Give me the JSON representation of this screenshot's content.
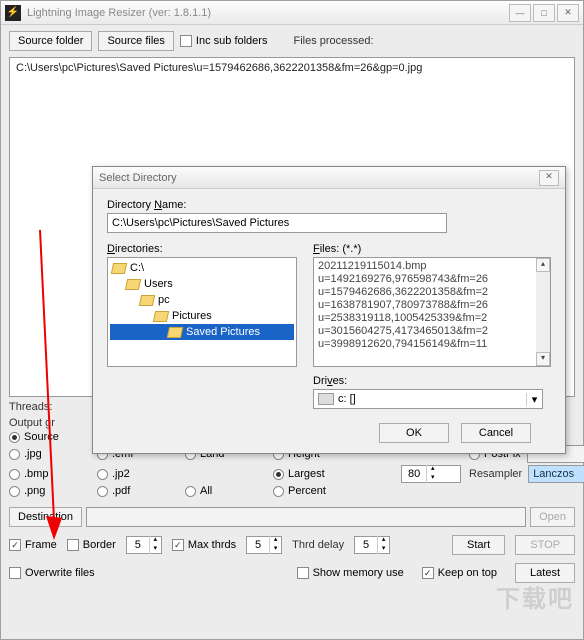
{
  "window": {
    "title": "Lightning Image Resizer (ver: 1.8.1.1)",
    "source_folder": "Source folder",
    "source_files": "Source files",
    "inc_sub": "Inc sub folders",
    "files_processed": "Files processed:",
    "file_path": "C:\\Users\\pc\\Pictures\\Saved Pictures\\u=1579462686,3622201358&fm=26&gp=0.jpg"
  },
  "threads_label": "Threads:",
  "output_group_label": "Output gr",
  "formats": {
    "source": "Source",
    "jpg": ".jpg",
    "bmp": ".bmp",
    "png": ".png",
    "emf": ".emf",
    "jp2": ".jp2",
    "pdf": ".pdf"
  },
  "orient": {
    "land": "Land",
    "all": "All"
  },
  "size": {
    "height": "Height",
    "largest": "Largest",
    "percent": "Percent",
    "value": "80"
  },
  "postfix_label": "PostFix",
  "resampler_label": "Resampler",
  "resampler_value": "Lanczos",
  "destination": {
    "btn": "Destination",
    "open": "Open"
  },
  "bottom": {
    "frame": "Frame",
    "border": "Border",
    "border_val": "5",
    "max_thrds": "Max thrds",
    "max_thrds_val": "5",
    "thrd_delay": "Thrd delay",
    "thrd_delay_val": "5",
    "start": "Start",
    "stop": "STOP",
    "overwrite": "Overwrite files",
    "show_mem": "Show memory use",
    "keep_top": "Keep on top",
    "latest": "Latest"
  },
  "dialog": {
    "title": "Select Directory",
    "dir_name_label_pre": "Directory ",
    "dir_name_label_u": "N",
    "dir_name_label_post": "ame:",
    "dir_name_value": "C:\\Users\\pc\\Pictures\\Saved Pictures",
    "directories_label_u": "D",
    "directories_label_post": "irectories:",
    "tree": [
      {
        "label": "C:\\",
        "indent": 0,
        "open": true
      },
      {
        "label": "Users",
        "indent": 1,
        "open": true
      },
      {
        "label": "pc",
        "indent": 2,
        "open": true
      },
      {
        "label": "Pictures",
        "indent": 3,
        "open": true
      },
      {
        "label": "Saved Pictures",
        "indent": 4,
        "open": true,
        "selected": true
      }
    ],
    "files_label_u": "F",
    "files_label_post": "iles: (*.*)",
    "files": [
      "20211219115014.bmp",
      "u=1492169276,976598743&fm=26",
      "u=1579462686,3622201358&fm=2",
      "u=1638781907,780973788&fm=26",
      "u=2538319118,1005425339&fm=2",
      "u=3015604275,4173465013&fm=2",
      "u=3998912620,794156149&fm=11"
    ],
    "drives_label_pre": "Dri",
    "drives_label_u": "v",
    "drives_label_post": "es:",
    "drives_value": "c: []",
    "ok": "OK",
    "cancel": "Cancel"
  },
  "watermark": "下载吧"
}
